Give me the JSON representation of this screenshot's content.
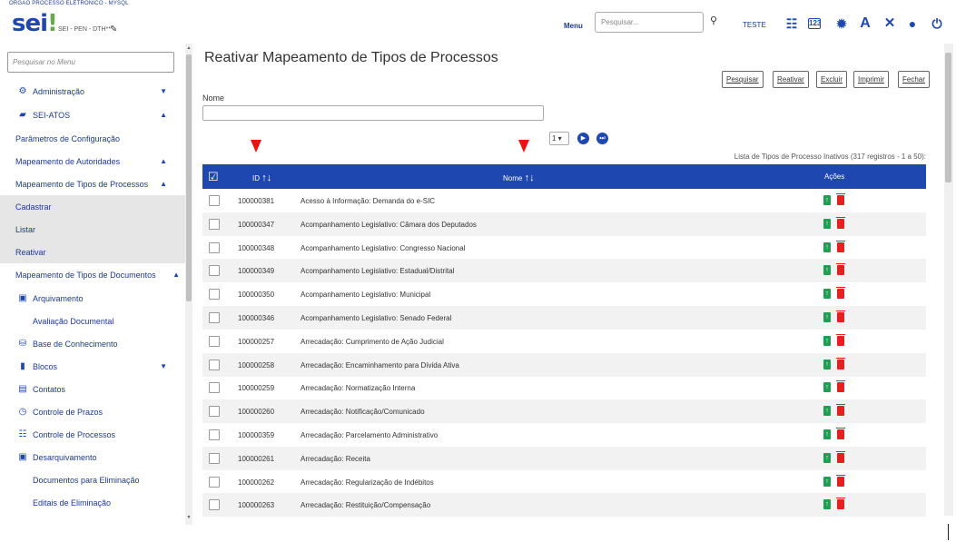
{
  "header": {
    "org_name": "ORGAO PROCESSO ELETRONICO - MYSQL",
    "logo_text": "sei",
    "logo_suffix": "!",
    "unit": "SEI - PEN - DTH**",
    "menu_label": "Menu",
    "search_placeholder": "Pesquisar...",
    "user": "TESTE",
    "icons": [
      "list-icon",
      "keyboard-icon",
      "bug-icon",
      "font-icon",
      "tools-icon",
      "user-icon",
      "power-icon"
    ]
  },
  "sidebar": {
    "search_placeholder": "Pesquisar no Menu",
    "items": [
      {
        "label": "Administração",
        "icon": "cogs-icon",
        "caret": "▼",
        "sub": false,
        "indent": false
      },
      {
        "label": "SEI-ATOS",
        "icon": "folder-icon",
        "caret": "▲",
        "sub": false,
        "indent": false
      },
      {
        "label": "Parâmetros de Configuração",
        "sub": false,
        "indent": false
      },
      {
        "label": "Mapeamento de Autoridades",
        "caret": "▲",
        "sub": false,
        "indent": false
      },
      {
        "label": "Mapeamento de Tipos de Processos",
        "caret": "▲",
        "sub": false,
        "indent": false
      },
      {
        "label": "Cadastrar",
        "sub": true,
        "indent": false
      },
      {
        "label": "Listar",
        "sub": true,
        "indent": false
      },
      {
        "label": "Reativar",
        "sub": true,
        "indent": false
      },
      {
        "label": "Mapeamento de Tipos de Documentos",
        "caret": "▲",
        "sub": false,
        "indent": false
      },
      {
        "label": "Arquivamento",
        "icon": "archive-icon",
        "sub": false,
        "indent": false
      },
      {
        "label": "Avaliação Documental",
        "sub": false,
        "indent": true
      },
      {
        "label": "Base de Conhecimento",
        "icon": "database-icon",
        "sub": false,
        "indent": false
      },
      {
        "label": "Blocos",
        "icon": "blocks-icon",
        "caret": "▼",
        "sub": false,
        "indent": false
      },
      {
        "label": "Contatos",
        "icon": "contact-card-icon",
        "sub": false,
        "indent": false
      },
      {
        "label": "Controle de Prazos",
        "icon": "clock-icon",
        "sub": false,
        "indent": false
      },
      {
        "label": "Controle de Processos",
        "icon": "list-icon",
        "sub": false,
        "indent": false
      },
      {
        "label": "Desarquivamento",
        "icon": "archive-icon",
        "sub": false,
        "indent": false
      },
      {
        "label": "Documentos para Eliminação",
        "sub": false,
        "indent": true
      },
      {
        "label": "Editais de Eliminação",
        "sub": false,
        "indent": true
      }
    ]
  },
  "page": {
    "title": "Reativar Mapeamento de Tipos de Processos",
    "buttons": [
      "Pesquisar",
      "Reativar",
      "Excluir",
      "Imprimir",
      "Fechar"
    ],
    "field_label": "Nome",
    "field_value": "",
    "page_select": "1",
    "caption": "Lista de Tipos de Processo Inativos (317 registros - 1 a 50):"
  },
  "table": {
    "headers": {
      "id": "ID",
      "name": "Nome",
      "actions": "Ações"
    },
    "rows": [
      {
        "id": "100000381",
        "name": "Acesso à Informação: Demanda do e-SIC"
      },
      {
        "id": "100000347",
        "name": "Acompanhamento Legislativo: Câmara dos Deputados"
      },
      {
        "id": "100000348",
        "name": "Acompanhamento Legislativo: Congresso Nacional"
      },
      {
        "id": "100000349",
        "name": "Acompanhamento Legislativo: Estadual/Distrital"
      },
      {
        "id": "100000350",
        "name": "Acompanhamento Legislativo: Municipal"
      },
      {
        "id": "100000346",
        "name": "Acompanhamento Legislativo: Senado Federal"
      },
      {
        "id": "100000257",
        "name": "Arrecadação: Cumprimento de Ação Judicial"
      },
      {
        "id": "100000258",
        "name": "Arrecadação: Encaminhamento para Dívida Ativa"
      },
      {
        "id": "100000259",
        "name": "Arrecadação: Normatização Interna"
      },
      {
        "id": "100000260",
        "name": "Arrecadação: Notificação/Comunicado"
      },
      {
        "id": "100000359",
        "name": "Arrecadação: Parcelamento Administrativo"
      },
      {
        "id": "100000261",
        "name": "Arrecadação: Receita"
      },
      {
        "id": "100000262",
        "name": "Arrecadação: Regularização de Indébitos"
      },
      {
        "id": "100000263",
        "name": "Arrecadação: Restituição/Compensação"
      }
    ]
  },
  "colors": {
    "accent": "#1f47b0",
    "reactivate": "#1f9e54",
    "delete": "#e52020",
    "marker": "#ee1111"
  }
}
